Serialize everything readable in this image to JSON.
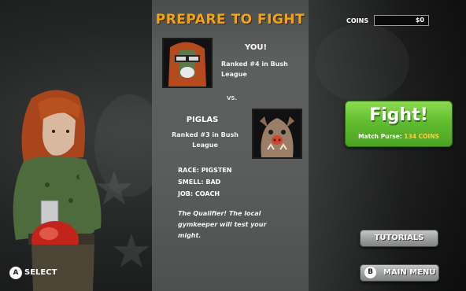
{
  "title": "PREPARE TO FIGHT",
  "coins": {
    "label": "COINS",
    "value": "$0"
  },
  "player": {
    "name": "YOU!",
    "rank": "Ranked #4 in Bush League"
  },
  "vs": "VS.",
  "opponent": {
    "name": "PIGLAS",
    "rank": "Ranked #3 in Bush League",
    "stats": [
      {
        "key": "RACE:",
        "value": "PIGSTEN"
      },
      {
        "key": "SMELL:",
        "value": "BAD"
      },
      {
        "key": "JOB:",
        "value": "COACH"
      }
    ],
    "description": "The Qualifier! The local gymkeeper will test your might."
  },
  "fight_button": {
    "label": "Fight!",
    "purse_label": "Match Purse:",
    "purse_amount": "134 COINS"
  },
  "tutorials_button": "TUTORIALS",
  "main_menu_button": {
    "key": "B",
    "label": "MAIN MENU"
  },
  "select_hint": {
    "key": "A",
    "label": "SELECT"
  },
  "colors": {
    "title": "#f2a514",
    "fight_green": "#62bd2f",
    "purse_gold": "#ffd23a",
    "panel": "#5a5d5c"
  },
  "icons": [
    "player-portrait",
    "opponent-portrait",
    "a-button-icon",
    "b-button-icon",
    "fighter-character"
  ]
}
